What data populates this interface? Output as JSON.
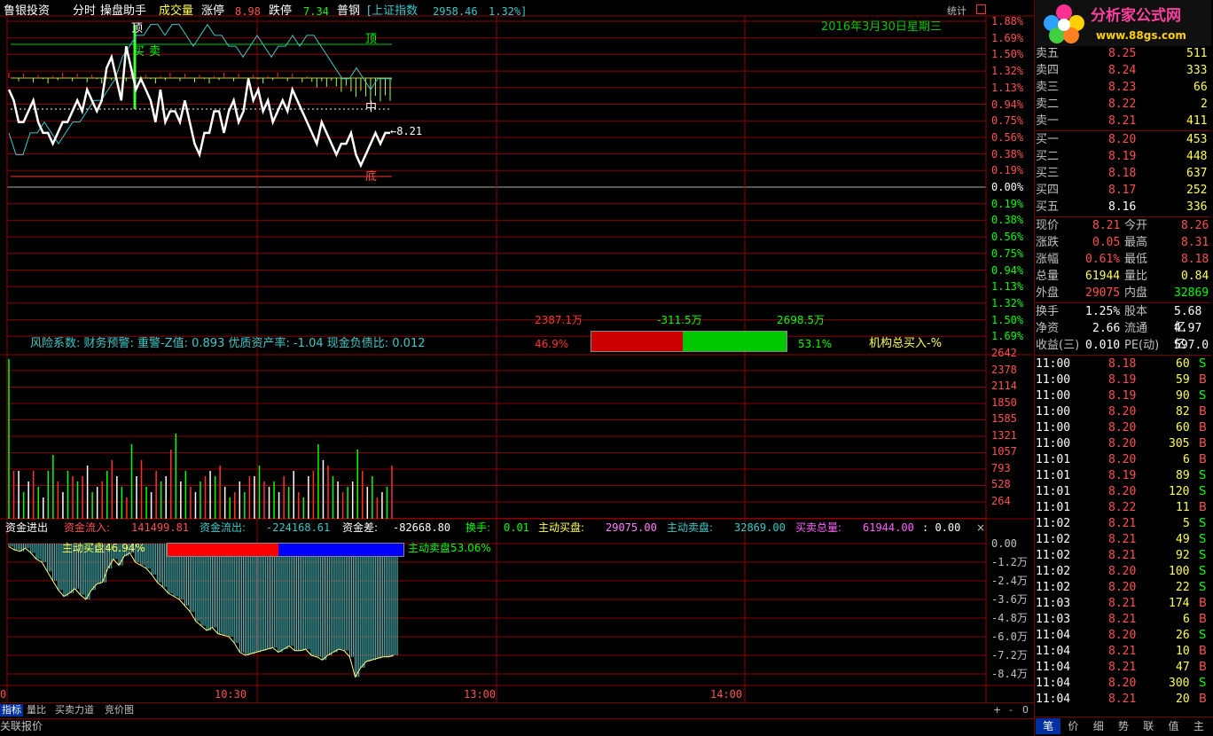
{
  "header": {
    "stock_name": "鲁银投资",
    "modes": [
      "分时",
      "操盘助手"
    ],
    "volume_label": "成交量",
    "limit_up_label": "涨停",
    "limit_up_value": "8.98",
    "limit_down_label": "跌停",
    "limit_down_value": "7.34",
    "category": "普钢",
    "index_text": "[上证指数",
    "index_value": "2958.46",
    "index_change": "1.32%]",
    "stats_button": "统计"
  },
  "price_chart": {
    "date_label": "2016年3月30日星期三",
    "annotations": {
      "top": "顶",
      "mid_left": "买",
      "mid_right": "卖",
      "center": "中",
      "bottom": "底",
      "last_price": "←8.21"
    },
    "pct_labels": [
      "1.88%",
      "1.69%",
      "1.50%",
      "1.32%",
      "1.13%",
      "0.94%",
      "0.75%",
      "0.56%",
      "0.38%",
      "0.19%",
      "0.00%",
      "0.19%",
      "0.38%",
      "0.56%",
      "0.75%",
      "0.94%",
      "1.13%",
      "1.32%",
      "1.50%",
      "1.69%"
    ],
    "white_line": [
      8.25,
      8.24,
      8.22,
      8.22,
      8.23,
      8.24,
      8.22,
      8.21,
      8.21,
      8.2,
      8.21,
      8.22,
      8.22,
      8.23,
      8.24,
      8.23,
      8.25,
      8.24,
      8.23,
      8.24,
      8.27,
      8.28,
      8.26,
      8.24,
      8.29,
      8.27,
      8.25,
      8.26,
      8.25,
      8.24,
      8.22,
      8.25,
      8.22,
      8.23,
      8.23,
      8.22,
      8.24,
      8.22,
      8.2,
      8.19,
      8.21,
      8.21,
      8.23,
      8.23,
      8.21,
      8.23,
      8.24,
      8.22,
      8.23,
      8.26,
      8.24,
      8.25,
      8.23,
      8.24,
      8.22,
      8.23,
      8.24,
      8.23,
      8.25,
      8.24,
      8.23,
      8.22,
      8.21,
      8.2,
      8.22,
      8.21,
      8.2,
      8.19,
      8.2,
      8.2,
      8.21,
      8.19,
      8.18,
      8.19,
      8.2,
      8.21,
      8.2,
      8.21,
      8.21
    ],
    "cyan_line": [
      8.21,
      8.19,
      8.19,
      8.21,
      8.21,
      8.22,
      8.21,
      8.2,
      8.21,
      8.22,
      8.22,
      8.23,
      8.24,
      8.24,
      8.25,
      8.26,
      8.28,
      8.29,
      8.3,
      8.3,
      8.31,
      8.31,
      8.3,
      8.31,
      8.31,
      8.3,
      8.29,
      8.3,
      8.31,
      8.3,
      8.3,
      8.29,
      8.29,
      8.28,
      8.29,
      8.3,
      8.29,
      8.28,
      8.29,
      8.29,
      8.3,
      8.29,
      8.3,
      8.3,
      8.29,
      8.28,
      8.27,
      8.26,
      8.26,
      8.27,
      8.26,
      8.25,
      8.26,
      8.26,
      8.26
    ]
  },
  "finance_bar": {
    "text": "风险系数: 财务预警: 重警-Z值: 0.893 优质资产率: -1.04 现金负债比: 0.012",
    "buy_amount": "2387.1万",
    "diff_amount": "-311.5万",
    "sell_amount": "2698.5万",
    "buy_pct": "46.9%",
    "sell_pct": "53.1%",
    "buy_ratio": 0.469,
    "inst_label": "机构总买入-%"
  },
  "volume_chart": {
    "labels": [
      "2642",
      "2378",
      "2114",
      "1850",
      "1585",
      "1321",
      "1057",
      "793",
      "528",
      "264"
    ],
    "bars": [
      3,
      0.9,
      0.9,
      0.5,
      0.7,
      0.9,
      0.6,
      0.4,
      0.9,
      1.2,
      0.7,
      0.5,
      0.9,
      0.8,
      0.7,
      0.8,
      1.0,
      0.5,
      0.6,
      0.7,
      0.9,
      1.1,
      0.8,
      0.6,
      0.4,
      1.4,
      0.8,
      1.1,
      0.6,
      0.5,
      0.9,
      0.7,
      0.8,
      1.3,
      1.6,
      0.7,
      0.9,
      0.6,
      0.5,
      0.7,
      0.8,
      0.9,
      0.8,
      1.0,
      0.6,
      0.4,
      0.5,
      0.7,
      0.5,
      0.8,
      0.8,
      1.0,
      0.7,
      0.6,
      0.7,
      0.5,
      0.8,
      0.6,
      0.9,
      0.5,
      0.4,
      0.8,
      0.9,
      1.4,
      1.1,
      1.0,
      0.8,
      0.7,
      0.5,
      0.6,
      0.7,
      1.3,
      0.9,
      0.6,
      0.8,
      0.4,
      0.5,
      0.6,
      1.0
    ],
    "colors": [
      "g",
      "r",
      "w",
      "g",
      "w",
      "r",
      "g",
      "w",
      "g",
      "g",
      "r",
      "w",
      "g",
      "r",
      "g",
      "r",
      "w",
      "g",
      "w",
      "r",
      "g",
      "r",
      "w",
      "g",
      "r",
      "g",
      "w",
      "r",
      "g",
      "w",
      "r",
      "g",
      "w",
      "r",
      "g",
      "w",
      "g",
      "r",
      "w",
      "g",
      "r",
      "w",
      "g",
      "r",
      "w",
      "g",
      "r",
      "w",
      "g",
      "r",
      "w",
      "g",
      "r",
      "w",
      "g",
      "w",
      "r",
      "g",
      "w",
      "r",
      "g",
      "w",
      "r",
      "g",
      "w",
      "r",
      "g",
      "w",
      "r",
      "g",
      "w",
      "g",
      "r",
      "w",
      "g",
      "r",
      "w",
      "g",
      "r"
    ]
  },
  "fund_flow": {
    "title": "资金进出",
    "inflow_label": "资金流入:",
    "inflow_value": "141499.81",
    "outflow_label": "资金流出:",
    "outflow_value": "-224168.61",
    "diff_label": "资金差:",
    "diff_value": "-82668.80",
    "turnover_label": "换手:",
    "turnover_value": "0.01",
    "active_buy_label": "主动买盘:",
    "active_buy_value": "29075.00",
    "active_sell_label": "主动卖盘:",
    "active_sell_value": "32869.00",
    "total_label": "买卖总量:",
    "total_value": "61944.00",
    "colon_value": ": 0.00",
    "close": "×",
    "active_buy_pct": "主动买盘46.94%",
    "active_sell_pct": "主动卖盘53.06%",
    "buy_ratio": 0.4694,
    "axis_labels": [
      "0.00",
      "-1.2万",
      "-2.4万",
      "-3.6万",
      "-4.8万",
      "-6.0万",
      "-7.2万",
      "-8.4万"
    ],
    "values": [
      -0.2,
      -0.4,
      -0.5,
      -0.3,
      -0.6,
      -1.0,
      -1.2,
      -1.8,
      -2.4,
      -3.0,
      -3.4,
      -3.2,
      -2.9,
      -3.3,
      -3.6,
      -3.0,
      -2.6,
      -2.5,
      -1.6,
      -1.0,
      -1.4,
      -0.8,
      -0.6,
      -1.2,
      -1.4,
      -1.6,
      -2.0,
      -2.5,
      -2.8,
      -3.2,
      -3.4,
      -3.6,
      -4.0,
      -4.4,
      -5.0,
      -5.3,
      -5.6,
      -5.4,
      -5.8,
      -5.9,
      -6.0,
      -6.4,
      -7.0,
      -7.2,
      -7.1,
      -7.0,
      -6.9,
      -6.8,
      -6.7,
      -7.0,
      -6.8,
      -6.6,
      -6.9,
      -6.9,
      -6.8,
      -7.2,
      -7.3,
      -7.5,
      -7.2,
      -7.0,
      -6.8,
      -6.9,
      -7.3,
      -8.6,
      -8.0,
      -7.6,
      -7.5,
      -7.4,
      -7.3,
      -7.3,
      -7.2
    ]
  },
  "time_axis": [
    "0",
    "10:30",
    "13:00",
    "14:00"
  ],
  "bottom_tabs": [
    "指标",
    "量比",
    "买卖力道",
    "竞价图"
  ],
  "bottom_controls": [
    "+",
    "-",
    "0"
  ],
  "status_bar": "关联报价",
  "logo": {
    "text": "分析家公式网",
    "url_text": "www.88gs.com"
  },
  "order_book": {
    "sell": [
      {
        "label": "卖五",
        "price": "8.25",
        "vol": "511"
      },
      {
        "label": "卖四",
        "price": "8.24",
        "vol": "333"
      },
      {
        "label": "卖三",
        "price": "8.23",
        "vol": "66"
      },
      {
        "label": "卖二",
        "price": "8.22",
        "vol": "2"
      },
      {
        "label": "卖一",
        "price": "8.21",
        "vol": "411"
      }
    ],
    "buy": [
      {
        "label": "买一",
        "price": "8.20",
        "vol": "453"
      },
      {
        "label": "买二",
        "price": "8.19",
        "vol": "448"
      },
      {
        "label": "买三",
        "price": "8.18",
        "vol": "637"
      },
      {
        "label": "买四",
        "price": "8.17",
        "vol": "252"
      },
      {
        "label": "买五",
        "price": "8.16",
        "vol": "336"
      }
    ]
  },
  "quote": [
    {
      "l1": "现价",
      "v1": "8.21",
      "l2": "今开",
      "v2": "8.26",
      "c1": "#ff5050",
      "c2": "#ff5050"
    },
    {
      "l1": "涨跌",
      "v1": "0.05",
      "l2": "最高",
      "v2": "8.31",
      "c1": "#ff5050",
      "c2": "#ff5050"
    },
    {
      "l1": "涨幅",
      "v1": "0.61%",
      "l2": "最低",
      "v2": "8.18",
      "c1": "#ff5050",
      "c2": "#ff5050"
    },
    {
      "l1": "总量",
      "v1": "61944",
      "l2": "量比",
      "v2": "0.84",
      "c1": "#ffff50",
      "c2": "#ffff50"
    },
    {
      "l1": "外盘",
      "v1": "29075",
      "l2": "内盘",
      "v2": "32869",
      "c1": "#ff5050",
      "c2": "#00ff00"
    }
  ],
  "fundamentals": [
    {
      "l1": "换手",
      "v1": "1.25%",
      "l2": "股本",
      "v2": "5.68亿"
    },
    {
      "l1": "净资",
      "v1": "2.66",
      "l2": "流通",
      "v2": "4.97亿"
    },
    {
      "l1": "收益(三)",
      "v1": "0.010",
      "l2": "PE(动)",
      "v2": "597.0"
    }
  ],
  "ticks": [
    {
      "time": "11:00",
      "price": "8.18",
      "vol": "60",
      "side": "S"
    },
    {
      "time": "11:00",
      "price": "8.19",
      "vol": "59",
      "side": "B"
    },
    {
      "time": "11:00",
      "price": "8.19",
      "vol": "90",
      "side": "S"
    },
    {
      "time": "11:00",
      "price": "8.20",
      "vol": "82",
      "side": "B"
    },
    {
      "time": "11:00",
      "price": "8.20",
      "vol": "60",
      "side": "B"
    },
    {
      "time": "11:00",
      "price": "8.20",
      "vol": "305",
      "side": "B"
    },
    {
      "time": "11:01",
      "price": "8.20",
      "vol": "6",
      "side": "B"
    },
    {
      "time": "11:01",
      "price": "8.19",
      "vol": "89",
      "side": "S"
    },
    {
      "time": "11:01",
      "price": "8.20",
      "vol": "120",
      "side": "S"
    },
    {
      "time": "11:01",
      "price": "8.22",
      "vol": "11",
      "side": "B"
    },
    {
      "time": "11:02",
      "price": "8.21",
      "vol": "5",
      "side": "S"
    },
    {
      "time": "11:02",
      "price": "8.21",
      "vol": "49",
      "side": "S"
    },
    {
      "time": "11:02",
      "price": "8.21",
      "vol": "92",
      "side": "S"
    },
    {
      "time": "11:02",
      "price": "8.20",
      "vol": "100",
      "side": "S"
    },
    {
      "time": "11:02",
      "price": "8.20",
      "vol": "22",
      "side": "S"
    },
    {
      "time": "11:03",
      "price": "8.21",
      "vol": "174",
      "side": "B"
    },
    {
      "time": "11:03",
      "price": "8.21",
      "vol": "6",
      "side": "B"
    },
    {
      "time": "11:04",
      "price": "8.20",
      "vol": "26",
      "side": "S"
    },
    {
      "time": "11:04",
      "price": "8.21",
      "vol": "10",
      "side": "B"
    },
    {
      "time": "11:04",
      "price": "8.21",
      "vol": "47",
      "side": "B"
    },
    {
      "time": "11:04",
      "price": "8.20",
      "vol": "300",
      "side": "S"
    },
    {
      "time": "11:04",
      "price": "8.21",
      "vol": "20",
      "side": "B"
    }
  ],
  "right_tabs": [
    "笔",
    "价",
    "细",
    "势",
    "联",
    "值",
    "主"
  ],
  "colors": {
    "up": "#ff5050",
    "down": "#00ff00",
    "grid": "#8b0000",
    "cyan": "#3cc8c8",
    "yellow": "#ffff50"
  }
}
